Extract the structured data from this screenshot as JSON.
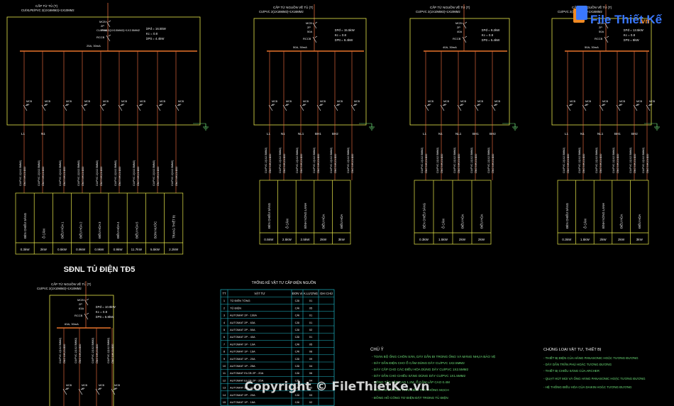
{
  "colors": {
    "background": "#000000",
    "panel_outline": "#e8e84a",
    "busbar": "#e8742a",
    "feeder": "#d9643a",
    "text_white": "#f2f2f2",
    "table_lines": "#1fb8c8",
    "ground": "#6fe07a",
    "logo_blue": "#3a78ff",
    "logo_orange": "#f08a24"
  },
  "watermark": {
    "logo_text": "File Thiết Kế",
    "logo_domain": ".vn",
    "copyright": "Copyright © FileThietKe.vn"
  },
  "panels": [
    {
      "source_label": "CẤP TỪ TỦ (T)",
      "source_cable": "CU/XLPE/PVC 2(1X16MM2)+1X10MM2",
      "mcb": "MCB",
      "mcb_rating": "2P\n100A",
      "rccb": "RCCB",
      "rccb_rating": "25A, 30mA",
      "cable_in": "CU/PVC 2(1X10MM2)+1X2.5MM2",
      "params": [
        "ΣPđ = 16.5kW",
        "Kc = 0.8",
        "ΣPtt = 4.4kW"
      ],
      "loads": [
        "ĐÈN CHIẾU SÁNG",
        "Ổ CẮM",
        "ĐIỀU HÒA 1",
        "ĐIỀU HÒA 2",
        "ĐIỀU HÒA 3",
        "ĐIỀU HÒA 4",
        "ĐIỀU HÒA 5",
        "BƠM NƯỚC",
        "TRANG THIẾT BỊ"
      ],
      "powers": [
        "0.3kW",
        "2kW",
        "0.5kW",
        "0.9kW",
        "0.9kW",
        "0.9kW",
        "11.7kW",
        "5.5kW",
        "2.2kW"
      ]
    },
    {
      "source_label": "CẤP TỪ NGUỒN VỀ TỦ (T)",
      "source_cable": "CU/PVC 2(1X16MM2)+1X16MM2",
      "mcb": "MCB",
      "mcb_rating": "2P\n50A",
      "rccb": "RCCB",
      "rccb_rating": "50A, 30mA",
      "cable_in": "",
      "params": [
        "ΣPđ = 15.5kW",
        "Kc = 0.8",
        "ΣPtt = 8.4kW"
      ],
      "loads": [
        "ĐÈN CHIẾU SÁNG",
        "Ổ CẮM",
        "BÌNH NÓNG LẠNH",
        "ĐIỀU HÒA",
        "ĐIỀU HÒA"
      ],
      "powers": [
        "0.5kW",
        "2.5kW",
        "2.5kW",
        "2kW",
        "3kW"
      ]
    },
    {
      "source_label": "CẤP TỪ NGUỒN VỀ TỦ (T)",
      "source_cable": "CU/PVC 2(1X10MM2)+1X10MM2",
      "mcb": "MCB",
      "mcb_rating": "2P\n40A",
      "rccb": "RCCB",
      "rccb_rating": "40A, 30mA",
      "cable_in": "",
      "params": [
        "ΣPđ = 9.2kW",
        "Kc = 0.8",
        "ΣPtt = 5.4kW"
      ],
      "loads": [
        "ĐÈN CHIẾU SÁNG",
        "Ổ CẮM",
        "ĐIỀU HÒA",
        "ĐIỀU HÒA"
      ],
      "powers": [
        "0.3kW",
        "1.5kW",
        "2kW",
        "2kW"
      ]
    },
    {
      "source_label": "CẤP TỪ NGUỒN VỀ TỦ (T)",
      "source_cable": "CU/PVC 2(1X16MM2)+1X16MM2",
      "mcb": "MCB",
      "mcb_rating": "2P\n50A",
      "rccb": "RCCB",
      "rccb_rating": "50A, 30mA",
      "cable_in": "",
      "params": [
        "ΣPđ = 13.5kW",
        "Kc = 0.8",
        "ΣPtt = 8kW"
      ],
      "loads": [
        "ĐÈN CHIẾU SÁNG",
        "Ổ CẮM",
        "BÌNH NÓNG LẠNH",
        "ĐIỀU HÒA",
        "ĐIỀU HÒA"
      ],
      "powers": [
        "0.3kW",
        "1.5kW",
        "2kW",
        "2kW",
        "3kW"
      ]
    },
    {
      "title": "SĐNL TỦ ĐIỆN TĐ5",
      "source_label": "CẤP TỪ NGUỒN VỀ TỦ (T)",
      "source_cable": "CU/PVC 2(1X10MM2)+1X10MM2",
      "mcb": "MCB",
      "mcb_rating": "2P\n63A",
      "rccb": "RCCB",
      "rccb_rating": "63A, 30mA",
      "cable_in": "",
      "params": [
        "ΣPđ = 10.9kW",
        "Kc = 0.8",
        "ΣPtt = 5.9kW"
      ],
      "loads": [
        "ĐÈN CHIẾU SÁNG",
        "Ổ CẮM",
        "ĐIỀU HÒA"
      ],
      "powers": []
    }
  ],
  "table": {
    "title": "THỐNG KÊ VẬT TƯ CẤP ĐIỆN NGUỒN",
    "headers": [
      "TT",
      "VẬT TƯ",
      "ĐƠN VỊ",
      "K.LƯỢNG",
      "GHI CHÚ"
    ],
    "rows": [
      [
        "1",
        "TỦ ĐIỆN TỔNG",
        "CÁI",
        "01",
        ""
      ],
      [
        "2",
        "TỦ ĐIỆN",
        "CÁI",
        "05",
        ""
      ],
      [
        "3",
        "AUTOMAT 2P - 100A",
        "CÁI",
        "01",
        ""
      ],
      [
        "4",
        "AUTOMAT 2P - 63A",
        "CÁI",
        "01",
        ""
      ],
      [
        "5",
        "AUTOMAT 2P - 50A",
        "CÁI",
        "02",
        ""
      ],
      [
        "6",
        "AUTOMAT 2P - 40A",
        "CÁI",
        "01",
        ""
      ],
      [
        "7",
        "AUTOMAT 1P - 10A",
        "CÁI",
        "05",
        ""
      ],
      [
        "8",
        "AUTOMAT 1P - 16A",
        "CÁI",
        "08",
        ""
      ],
      [
        "9",
        "AUTOMAT 1P - 20A",
        "CÁI",
        "09",
        ""
      ],
      [
        "10",
        "AUTOMAT 1P - 25A",
        "CÁI",
        "04",
        ""
      ],
      [
        "11",
        "AUTOMAT ELCB 2P - 20A",
        "CÁI",
        "06",
        ""
      ],
      [
        "12",
        "AUTOMAT ELCB 2P - 25A",
        "CÁI",
        "04",
        ""
      ],
      [
        "13",
        "AUTOMAT 2P - 32A",
        "CÁI",
        "02",
        ""
      ],
      [
        "14",
        "AUTOMAT 2P - 20A",
        "CÁI",
        "03",
        ""
      ],
      [
        "15",
        "AUTOMAT 1P - 16A",
        "CÁI",
        "02",
        ""
      ]
    ]
  },
  "notes": {
    "title": "CHÚ Ý",
    "lines": [
      "- TOÀN BỘ ỐNG CHÔN SÀN, DÂY DẪN ĐI TRONG ỐNG VÀ MÁNG NHỰA BẢO VỆ",
      "- DÂY DẪN ĐIỆN CHO Ổ CẮM DÙNG DÂY CU/PVC 1X2.5MM2",
      "- DÂY CẤP CHO CÁC ĐIỀU HÒA DÙNG DÂY CU/PVC 1X2.5MM2",
      "- DÂY DẪN CHO CHIẾU SÁNG DÙNG DÂY CU/PVC 1X1.5MM2",
      "- CÔNG TẮC LẮP CAO 1.2M, Ổ CẮM LẮP CAO 0.4M",
      "- SAU KHI LẮP ĐẶT PHẢI KIỂM TRA THÔNG MẠCH",
      "- ĐỒNG HỒ CÔNG TƠ ĐIỆN ĐẶT TRONG TỦ ĐIỆN"
    ]
  },
  "legend": {
    "title": "CHỦNG LOẠI VẬT TƯ, THIẾT BỊ",
    "lines": [
      "- THIẾT BỊ ĐIỆN CỦA HÃNG PANASONIC HOẶC TƯƠNG ĐƯƠNG",
      "- DÂY DẪN TRẦN PHÚ HOẶC TƯƠNG ĐƯƠNG",
      "- THIẾT BỊ CHIẾU SÁNG CỦA ARCHER",
      "- QUẠT HÚT MÙI VÀ ỐNG HÀNG PANASONIC HOẶC TƯƠNG ĐƯƠNG",
      "- HỆ THỐNG ĐIỀU HÒA CỦA DAIKIN HOẶC TƯƠNG ĐƯƠNG"
    ]
  }
}
